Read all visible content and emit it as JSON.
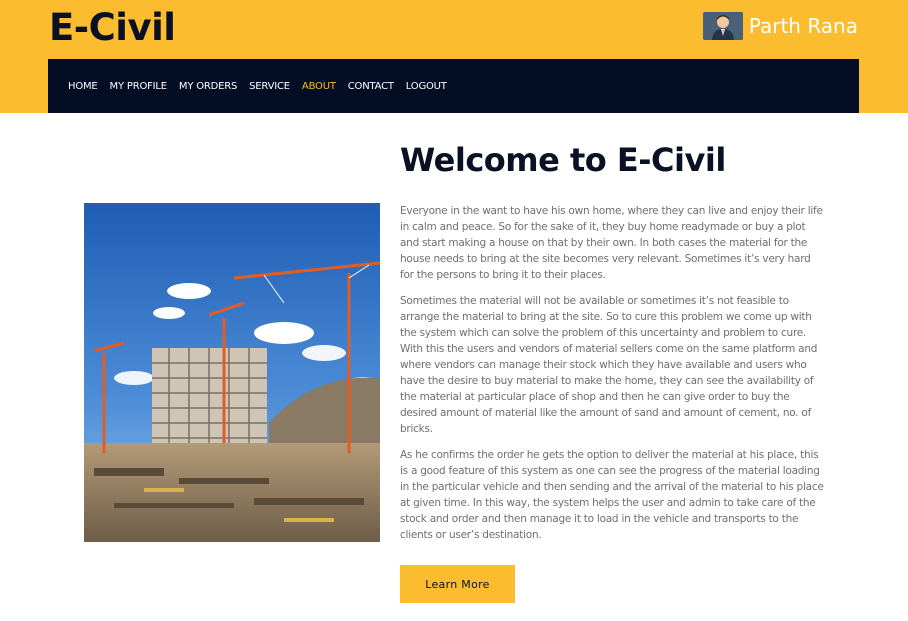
{
  "header": {
    "brand": "E-Civil",
    "user_name": "Parth Rana",
    "background_color": "#fbbd2f"
  },
  "nav": {
    "items": [
      {
        "label": "HOME"
      },
      {
        "label": "MY PROFILE"
      },
      {
        "label": "MY ORDERS"
      },
      {
        "label": "SERVICE"
      },
      {
        "label": "ABOUT",
        "active": true
      },
      {
        "label": "CONTACT"
      },
      {
        "label": "LOGOUT"
      }
    ],
    "background_color": "#030d24",
    "active_color": "#fbbd2f"
  },
  "main": {
    "title": "Welcome to E-Civil",
    "paragraphs": [
      "Everyone in the want to have his own home, where they can live and enjoy their life in calm and peace. So for the sake of it, they buy home readymade or buy a plot and start making a house on that by their own. In both cases the material for the house needs to bring at the site becomes very relevant. Sometimes it’s very hard for the persons to bring it to their places.",
      "Sometimes the material will not be available or sometimes it’s not feasible to arrange the material to bring at the site. So to cure this problem we come up with the system which can solve the problem of this uncertainty and problem to cure. With this the users and vendors of material sellers come on the same platform and where vendors can manage their stock which they have available and users who have the desire to buy material to make the home, they can see the availability of the material at particular place of shop and then he can give order to buy the desired amount of material like the amount of sand and amount of cement, no. of bricks.",
      "As he confirms the order he gets the option to deliver the material at his place, this is a good feature of this system as one can see the progress of the material loading in the particular vehicle and then sending and the arrival of the material to his place at given time. In this way, the system helps the user and admin to take care of the stock and order and then manage it to load in the vehicle and transports to the clients or user’s destination."
    ],
    "button_label": "Learn More",
    "image_icon": "construction-site-photo"
  }
}
